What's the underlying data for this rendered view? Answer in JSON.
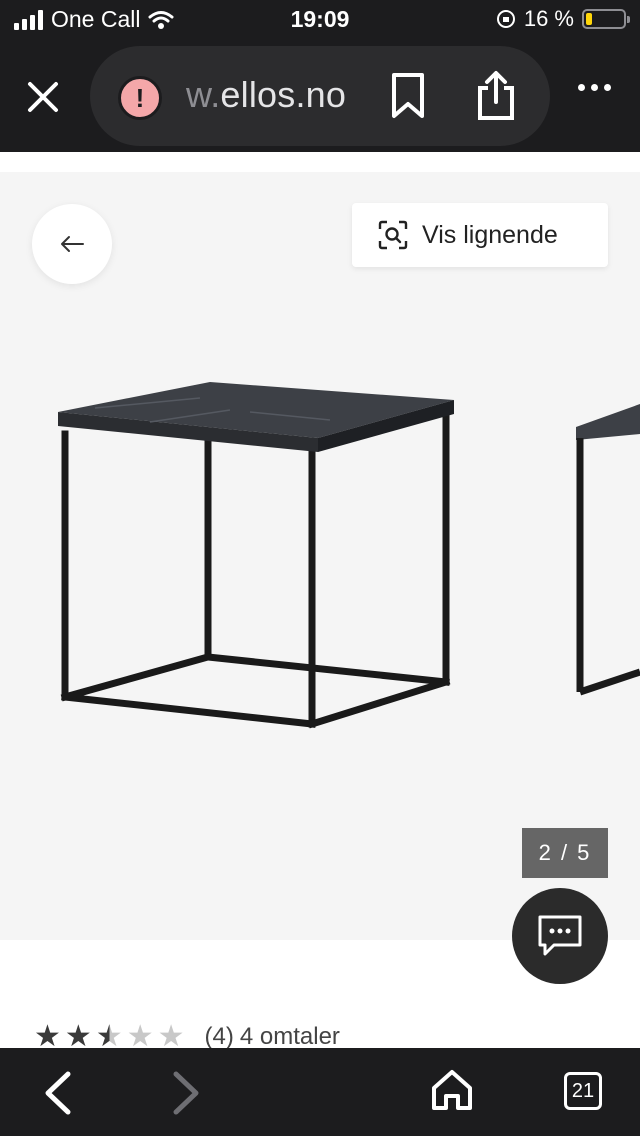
{
  "status_bar": {
    "carrier": "One Call",
    "time": "19:09",
    "battery": "16 %",
    "battery_level": 0.16
  },
  "browser": {
    "url_dim": "w.",
    "url_main": "ellos.no",
    "tab_count": "21"
  },
  "gallery": {
    "similar_label": "Vis lignende",
    "counter": "2 / 5"
  },
  "product": {
    "rating": 2.5,
    "rating_max": 5,
    "review_count": "(4)",
    "reviews_label": "4 omtaler"
  },
  "colors": {
    "browser_bg": "#1c1c1e",
    "gallery_bg": "#f5f5f5",
    "accent_warning": "#f4a7a9",
    "battery_fill": "#ffd60a"
  },
  "icons": [
    "close-icon",
    "warning-icon",
    "bookmark-icon",
    "share-icon",
    "more-icon",
    "arrow-left-icon",
    "visual-search-icon",
    "chat-icon",
    "star-icon",
    "chevron-left-icon",
    "chevron-right-icon",
    "home-icon",
    "tabs-icon"
  ]
}
